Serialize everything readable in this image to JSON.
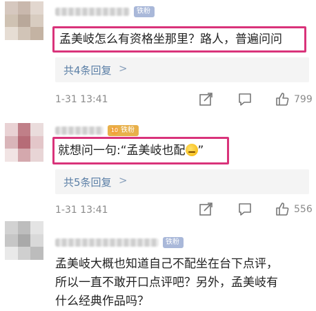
{
  "comments": [
    {
      "badge": "铁粉",
      "text": "孟美岐怎么有资格坐那里？路人，普遍问问",
      "reply_label": "共4条回复",
      "reply_arrow": ">",
      "timestamp": "1-31 13:41",
      "likes": "799"
    },
    {
      "badge": "铁粉",
      "badge_level": "10",
      "text": "就想问一句:“孟美岐也配",
      "text_tail": "”",
      "reply_label": "共5条回复",
      "reply_arrow": ">",
      "timestamp": "1-31 13:41",
      "likes": "556"
    },
    {
      "badge": "铁粉",
      "lines": [
        "孟美岐大概也知道自己不配坐在台下点评，",
        "所以一直不敢开口点评吧？另外，孟美岐有",
        "什么经典作品吗？"
      ]
    }
  ],
  "colors": {
    "highlight": "#d9337a",
    "reply_link": "#5b7fa6",
    "meta": "#8a8a8a"
  }
}
